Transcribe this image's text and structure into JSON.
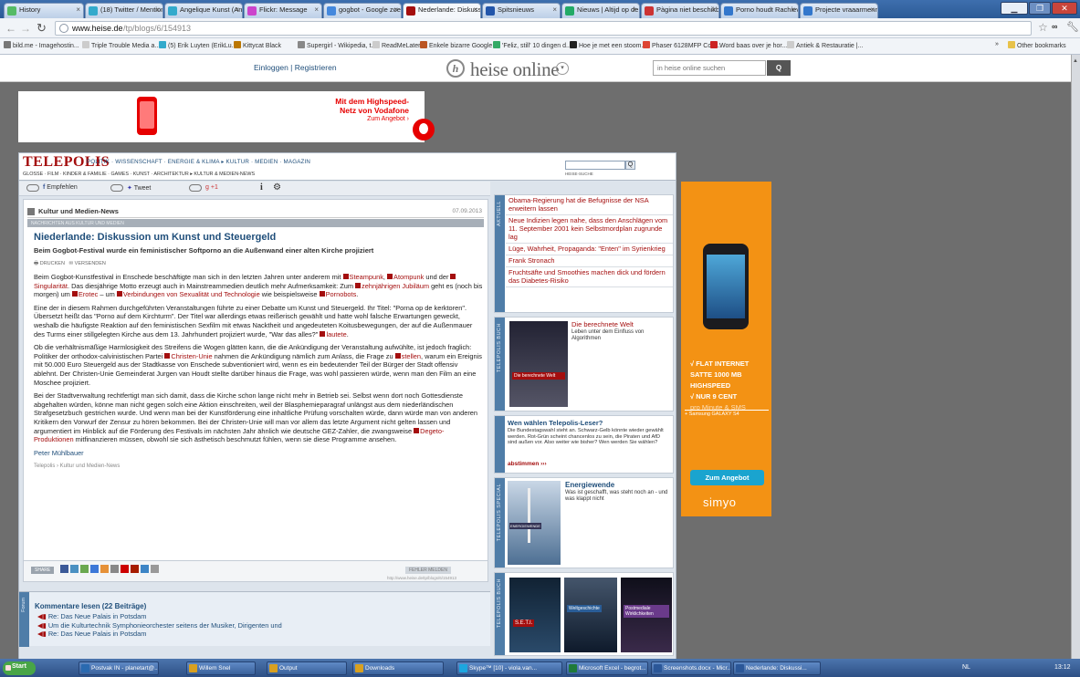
{
  "browser": {
    "tabs": [
      "History",
      "(18) Twitter / Mentions",
      "Angelique Kunst (Ang...",
      "Flickr: Message",
      "gogbot - Google zoeken",
      "Nederlande: Diskussio...",
      "Spitsnieuws",
      "Nieuws | Altijd op de h...",
      "Pàgina niet beschikbaa...",
      "Porno houdt Rachieve...",
      "Projecte vraaarmenn..."
    ],
    "active_tab": 5,
    "url_host": "www.heise.de",
    "url_path": "/tp/blogs/6/154913",
    "bookmarks": [
      "bild.me - Imagehostin...",
      "Triple Trouble Media a...",
      "(5) Erik Luyten (ErikLu...",
      "Kittycat Black",
      "Supergirl - Wikipedia, t...",
      "ReadMeLater",
      "Enkele bizarre Google ...",
      "'Feliz, still' 10 dingen d...",
      "Hoe je met een stoom...",
      "Phaser 6128MFP Cont...",
      "Word baas over je hor...",
      "Antiek & Restauratie |..."
    ],
    "other_bookmarks": "Other bookmarks"
  },
  "heise": {
    "login": "Einloggen | Registrieren",
    "logo": "heise online",
    "search_placeholder": "in heise online suchen",
    "search_button": "Q"
  },
  "ad_left": {
    "line1": "Mit dem Highspeed-",
    "line2": "Netz von Vodafone",
    "line3": "Zum Angebot ›"
  },
  "telepolis": {
    "logo": "TELEPOLIS",
    "nav": "POLITIK · WISSENSCHAFT · ENERGIE & KLIMA ▸ KULTUR · MEDIEN · MAGAZIN",
    "subnav": "GLOSSE · FILM · KINDER & FAMILIE · GAMES · KUNST · ARCHITEKTUR ▸ KULTUR & MEDIEN-NEWS",
    "search_label": "HEISE-SUCHE",
    "social": {
      "fb": "Empfehlen",
      "tw": "Tweet",
      "gp": "+1"
    }
  },
  "article": {
    "section": "Kultur und Medien-News",
    "date": "07.09.2013",
    "section_sub": "NACHRICHTEN AUS KULTUR UND MEDIEN",
    "title": "Niederlande: Diskussion um Kunst und Steuergeld",
    "subtitle": "Beim Gogbot-Festival wurde ein feministischer Softporno an die Außenwand einer alten Kirche projiziert",
    "print": "DRUCKEN",
    "send": "VERSENDEN",
    "p1": [
      {
        "t": "Beim Gogbot-Kunstfestival in Enschede beschäftigte man sich in den letzten Jahren unter anderem mit "
      },
      {
        "t": "Steampunk",
        "l": true
      },
      {
        "t": ", "
      },
      {
        "t": "Atompunk",
        "l": true
      },
      {
        "t": " und der "
      },
      {
        "t": "Singularität",
        "l": true
      },
      {
        "t": ". Das diesjährige Motto erzeugt auch in Mainstreammedien deutlich mehr Aufmerksamkeit: Zum "
      },
      {
        "t": "zehnjährigen Jubiläum",
        "l": true
      },
      {
        "t": " geht es (noch bis morgen) um "
      },
      {
        "t": "Erotec",
        "l": true
      },
      {
        "t": " – um "
      },
      {
        "t": "Verbindungen von Sexualität und Technologie",
        "l": true
      },
      {
        "t": " wie beispielsweise "
      },
      {
        "t": "Pornobots",
        "l": true
      },
      {
        "t": "."
      }
    ],
    "p2": [
      {
        "t": "Eine der in diesem Rahmen durchgeführten Veranstaltungen führte zu einer Debatte um Kunst und Steuergeld. Ihr Titel: \"Porna op de kerktoren\". Übersetzt heißt das \"Porno auf dem Kirchturm\". Der Titel war allerdings etwas reißerisch gewählt und hatte wohl falsche Erwartungen geweckt, weshalb die häufigste Reaktion auf den feministischen Sexfilm mit etwas Nacktheit und angedeuteten Koitusbewegungen, der auf die Außenmauer des Turms einer stillgelegten Kirche aus dem 13. Jahrhundert projiziert wurde, \"War das alles?\" "
      },
      {
        "t": "lautete",
        "l": true
      },
      {
        "t": "."
      }
    ],
    "p3": [
      {
        "t": "Ob die verhältnismäßige Harmlosigkeit des Streifens die Wogen glätten kann, die die Ankündigung der Veranstaltung aufwühlte, ist jedoch fraglich: Politiker der orthodox-calvinistischen Partei "
      },
      {
        "t": "Christen-Unie",
        "l": true
      },
      {
        "t": " nahmen die Ankündigung nämlich zum Anlass, die Frage zu "
      },
      {
        "t": "stellen",
        "l": true
      },
      {
        "t": ", warum ein Ereignis mit 50.000 Euro Steuergeld aus der Stadtkasse von Enschede subventioniert wird, wenn es ein bedeutender Teil der Bürger der Stadt offensiv ablehnt. Der Christen-Unie Gemeinderat Jurgen van Houdt stellte darüber hinaus die Frage, was wohl passieren würde, wenn man den Film an eine Moschee projiziert."
      }
    ],
    "p4": [
      {
        "t": "Bei der Stadtverwaltung rechtfertigt man sich damit, dass die Kirche schon lange nicht mehr in Betrieb sei. Selbst wenn dort noch Gottesdienste abgehalten würden, könne man nicht gegen solch eine Aktion einschreiten, weil der Blasphemieparagraf unlängst aus dem niederländischen Strafgesetzbuch gestrichen wurde. Und wenn man bei der Kunstförderung eine inhaltliche Prüfung vorschalten würde, dann würde man von anderen Kritikern den Vorwurf der Zensur zu hören bekommen. Bei der Christen-Unie will man vor allem das letzte Argument nicht gelten lassen und argumentiert im Hinblick auf die Förderung des Festivals im nächsten Jahr ähnlich wie deutsche GEZ-Zahler, die zwangsweise "
      },
      {
        "t": "Degeto-Produktionen",
        "l": true
      },
      {
        "t": " mitfinanzieren müssen, obwohl sie sich ästhetisch beschmutzt fühlen, wenn sie diese Programme ansehen."
      }
    ],
    "author": "Peter Mühlbauer",
    "crumb": "Telepolis › Kultur und Medien-News",
    "share": "SHARE",
    "error": "FEHLER MELDEN",
    "shorturl": "http://www.heise.de/tp/blogs/6/154913"
  },
  "comments": {
    "tab": "Forum",
    "title": "Kommentare lesen (22 Beiträge)",
    "items": [
      "Re: Das Neue Palais in Potsdam",
      "Um die Kulturtechnik Symphonieorchester seitens der Musiker, Dirigenten und",
      "Re: Das Neue Palais in Potsdam"
    ]
  },
  "sidebar": {
    "news_tab": "AKTUELL",
    "news": [
      "Obama-Regierung hat die Befugnisse der NSA erweitern lassen",
      "Neue Indizien legen nahe, dass den Anschlägen vom 11. September 2001 kein Selbstmordplan zugrunde lag",
      "Lüge, Wahrheit, Propaganda: \"Enten\" im Syrienkrieg",
      "Frank Stronach",
      "Fruchtsäfte und Smoothies machen dick und fördern das Diabetes-Risiko"
    ],
    "book_tab": "TELEPOLIS BUCH",
    "book_title": "Die berechnete Welt",
    "book_sub": "Leben unter dem Einfluss von Algorithmen",
    "book_cover": "Die berechnete Welt",
    "poll_title": "Wen wählen Telepolis-Leser?",
    "poll_text": "Die Bundestagswahl steht an. Schwarz-Gelb könnte wieder gewählt werden. Rot-Grün scheint chancenlos zu sein, die Piraten und AfD sind außen vor. Also weiter wie bisher? Wen werden Sie wählen?",
    "poll_link": "abstimmen ›››",
    "spec_tab": "TELEPOLIS SPECIAL",
    "energy_title": "Energiewende",
    "energy_text": "Was ist geschafft, was steht noch an - und was klappt nicht",
    "energy_label": "ENERGIEWENDE",
    "books_tab": "TELEPOLIS BUCH",
    "cover1": "S.E.T.I.",
    "cover2": "Weltgeschichte",
    "cover3": "Postmediale Wirklichkeiten"
  },
  "ad_right": {
    "l1": "√ FLAT INTERNET",
    "l2": "SATTE 1000 MB",
    "l3": "HIGHSPEED",
    "l4": "√ NUR 9 CENT",
    "l5": "pro Minute & SMS",
    "l6": "+ Samsung GALAXY S4",
    "button": "Zum Angebot",
    "brand": "simyo"
  },
  "taskbar": {
    "start": "Start",
    "items": [
      "Postvak IN - planetart@...",
      "Willem Snel",
      "Output",
      "Downloads",
      "Skype™ [10] - viola.van...",
      "Microsoft Excel - begrot...",
      "Screenshots.docx - Micr...",
      "Nederlande: Diskussi..."
    ],
    "lang": "NL",
    "clock": "13:12"
  },
  "colors": {
    "accent_red": "#a40e0e",
    "telepolis_blue": "#1f4e7a",
    "ad_orange": "#f39214"
  }
}
